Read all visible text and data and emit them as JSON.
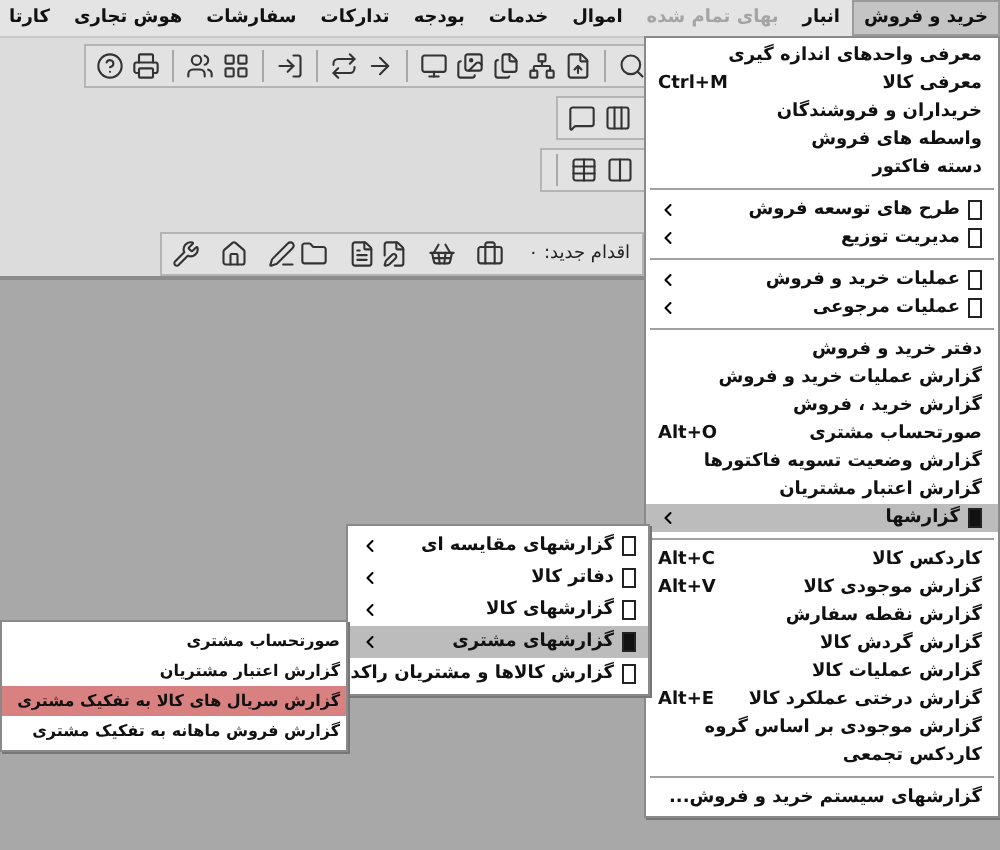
{
  "menu_bar": [
    {
      "label": "خرید و فروش",
      "selected": true,
      "disabled": false
    },
    {
      "label": "انبار",
      "selected": false,
      "disabled": false
    },
    {
      "label": "بهای تمام شده",
      "selected": false,
      "disabled": true
    },
    {
      "label": "اموال",
      "selected": false,
      "disabled": false
    },
    {
      "label": "خدمات",
      "selected": false,
      "disabled": false
    },
    {
      "label": "بودجه",
      "selected": false,
      "disabled": false
    },
    {
      "label": "تدارکات",
      "selected": false,
      "disabled": false
    },
    {
      "label": "سفارشات",
      "selected": false,
      "disabled": false
    },
    {
      "label": "هوش تجاری",
      "selected": false,
      "disabled": false
    },
    {
      "label": "کارتا",
      "selected": false,
      "disabled": false
    }
  ],
  "action_toolbar": {
    "label": "اقدام جدید: ٠"
  },
  "main_menu": {
    "items": [
      {
        "kind": "item",
        "label": "معرفی واحدهای اندازه گیری",
        "selected": false
      },
      {
        "kind": "item",
        "label": "معرفی کالا",
        "shortcut": "Ctrl+M",
        "selected": false
      },
      {
        "kind": "item",
        "label": "خریداران و فروشندگان",
        "selected": false
      },
      {
        "kind": "item",
        "label": "واسطه های فروش",
        "selected": false
      },
      {
        "kind": "item",
        "label": "دسته فاکتور",
        "selected": false
      },
      {
        "kind": "separator"
      },
      {
        "kind": "submenu",
        "label": "طرح های توسعه فروش",
        "selected": false
      },
      {
        "kind": "submenu",
        "label": "مدیریت توزیع",
        "selected": false
      },
      {
        "kind": "separator"
      },
      {
        "kind": "submenu",
        "label": "عملیات خرید و فروش",
        "selected": false
      },
      {
        "kind": "submenu",
        "label": "عملیات مرجوعی",
        "selected": false
      },
      {
        "kind": "separator"
      },
      {
        "kind": "item",
        "label": "دفتر خرید و فروش",
        "selected": false
      },
      {
        "kind": "item",
        "label": "گزارش عملیات خرید و فروش",
        "selected": false
      },
      {
        "kind": "item",
        "label": "گزارش خرید ، فروش",
        "selected": false
      },
      {
        "kind": "item",
        "label": "صورتحساب مشتری",
        "shortcut": "Alt+O",
        "selected": false
      },
      {
        "kind": "item",
        "label": "گزارش وضعیت تسویه فاکتورها",
        "selected": false
      },
      {
        "kind": "item",
        "label": "گزارش اعتبار مشتریان",
        "selected": false
      },
      {
        "kind": "submenu",
        "label": "گزارشها",
        "selected": true
      },
      {
        "kind": "separator"
      },
      {
        "kind": "item",
        "label": "کاردکس کالا",
        "shortcut": "Alt+C",
        "selected": false
      },
      {
        "kind": "item",
        "label": "گزارش موجودی کالا",
        "shortcut": "Alt+V",
        "selected": false
      },
      {
        "kind": "item",
        "label": "گزارش نقطه سفارش",
        "selected": false
      },
      {
        "kind": "item",
        "label": "گزارش گردش کالا",
        "selected": false
      },
      {
        "kind": "item",
        "label": "گزارش عملیات کالا",
        "selected": false
      },
      {
        "kind": "item",
        "label": "گزارش درختی عملکرد کالا",
        "shortcut": "Alt+E",
        "selected": false
      },
      {
        "kind": "item",
        "label": "گزارش موجودی بر اساس گروه",
        "selected": false
      },
      {
        "kind": "item",
        "label": "کاردکس تجمعی",
        "selected": false
      },
      {
        "kind": "separator"
      },
      {
        "kind": "item",
        "label": "گزارشهای سیستم خرید و فروش...",
        "selected": false
      }
    ]
  },
  "reports_menu": {
    "items": [
      {
        "kind": "submenu",
        "label": "گزارشهای مقایسه ای",
        "selected": false
      },
      {
        "kind": "submenu",
        "label": "دفاتر کالا",
        "selected": false
      },
      {
        "kind": "submenu",
        "label": "گزارشهای کالا",
        "selected": false
      },
      {
        "kind": "submenu",
        "label": "گزارشهای مشتری",
        "selected": true
      },
      {
        "kind": "submenu",
        "label": "گزارش کالاها و مشتریان راکد",
        "selected": false
      }
    ]
  },
  "customer_reports_menu": {
    "items": [
      {
        "kind": "item",
        "label": "صورتحساب مشتری",
        "selected": false
      },
      {
        "kind": "item",
        "label": "گزارش اعتبار مشتریان",
        "selected": false
      },
      {
        "kind": "item",
        "label": "گزارش سریال های کالا به تفکیک مشتری",
        "selected": true
      },
      {
        "kind": "item",
        "label": "گزارش فروش ماهانه به تفکیک مشتری",
        "selected": false
      }
    ]
  }
}
